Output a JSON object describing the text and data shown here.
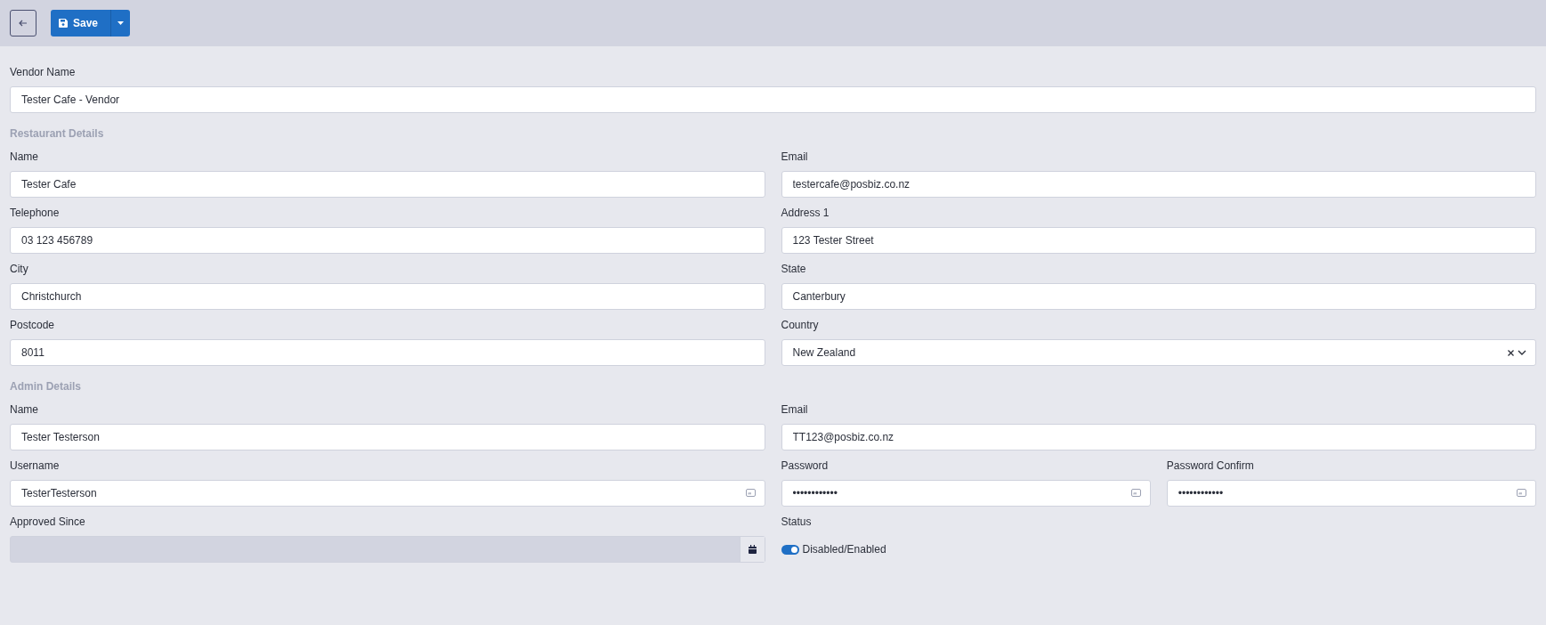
{
  "toolbar": {
    "save_label": "Save"
  },
  "vendor": {
    "label": "Vendor Name",
    "value": "Tester Cafe - Vendor"
  },
  "sections": [
    {
      "title": "Restaurant Details",
      "rows": [
        [
          {
            "kind": "text",
            "label": "Name",
            "value": "Tester Cafe"
          },
          {
            "kind": "text",
            "label": "Email",
            "value": "testercafe@posbiz.co.nz"
          }
        ],
        [
          {
            "kind": "text",
            "label": "Telephone",
            "value": "03 123 456789"
          },
          {
            "kind": "text",
            "label": "Address 1",
            "value": "123 Tester Street"
          }
        ],
        [
          {
            "kind": "text",
            "label": "City",
            "value": "Christchurch"
          },
          {
            "kind": "text",
            "label": "State",
            "value": "Canterbury"
          }
        ],
        [
          {
            "kind": "text",
            "label": "Postcode",
            "value": "8011"
          },
          {
            "kind": "select",
            "label": "Country",
            "value": "New Zealand"
          }
        ]
      ]
    },
    {
      "title": "Admin Details",
      "rows": [
        [
          {
            "kind": "text",
            "label": "Name",
            "value": "Tester Testerson"
          },
          {
            "kind": "text",
            "label": "Email",
            "value": "TT123@posbiz.co.nz"
          }
        ],
        [
          {
            "kind": "password",
            "label": "Username",
            "value": "TesterTesterson"
          },
          {
            "kind": "password",
            "label": "Password",
            "value": "••••••••••••"
          },
          {
            "kind": "password",
            "label": "Password Confirm",
            "value": "••••••••••••"
          }
        ],
        [
          {
            "kind": "date",
            "label": "Approved Since",
            "disabled": true
          },
          {
            "kind": "toggle",
            "label": "Status",
            "text": "Disabled/Enabled",
            "on": true
          }
        ]
      ]
    }
  ]
}
